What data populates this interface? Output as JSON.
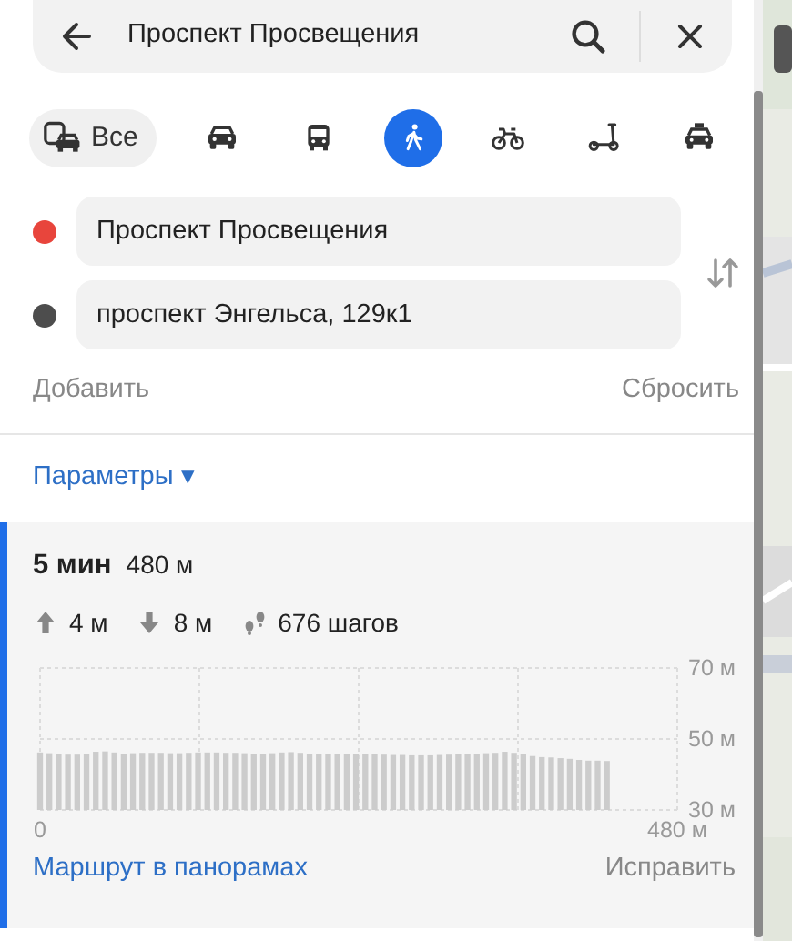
{
  "search": {
    "value": "Проспект Просвещения"
  },
  "modes": [
    {
      "kind": "all",
      "label": "Все",
      "selected": false
    },
    {
      "kind": "car",
      "selected": false
    },
    {
      "kind": "bus",
      "selected": false
    },
    {
      "kind": "walk",
      "selected": true
    },
    {
      "kind": "bike",
      "selected": false
    },
    {
      "kind": "scooter",
      "selected": false
    },
    {
      "kind": "taxi",
      "selected": false
    }
  ],
  "route_points": [
    {
      "value": "Проспект Просвещения",
      "color": "#e8453c"
    },
    {
      "value": "проспект Энгельса, 129к1",
      "color": "#4d4d4d"
    }
  ],
  "add_label": "Добавить",
  "reset_label": "Сбросить",
  "parameters": {
    "label": "Параметры",
    "caret": "▾"
  },
  "route": {
    "selected": true,
    "time": "5 мин",
    "distance": "480 м",
    "ascent": "4 м",
    "descent": "8 м",
    "steps": "676 шагов",
    "chart_data": {
      "type": "bar",
      "xlim": [
        0,
        480
      ],
      "ylim": [
        30,
        70
      ],
      "xticks": [
        {
          "value": 0,
          "label": "0"
        },
        {
          "value": 480,
          "label": "480 м"
        }
      ],
      "yticks": [
        {
          "value": 70,
          "label": "70 м"
        },
        {
          "value": 50,
          "label": "50 м"
        },
        {
          "value": 30,
          "label": "30 м"
        }
      ],
      "x": [
        0,
        7,
        14,
        21,
        28,
        35,
        42,
        49,
        56,
        63,
        70,
        77,
        84,
        91,
        98,
        105,
        112,
        119,
        126,
        133,
        140,
        147,
        154,
        161,
        168,
        175,
        182,
        189,
        196,
        203,
        210,
        217,
        224,
        231,
        238,
        245,
        252,
        259,
        266,
        273,
        280,
        287,
        294,
        301,
        308,
        315,
        322,
        329,
        336,
        343,
        350,
        357,
        364,
        371,
        378,
        385,
        392,
        399,
        406,
        413,
        420,
        427
      ],
      "values": [
        46.2,
        46,
        45.8,
        45.6,
        45.6,
        45.9,
        46.4,
        46.5,
        46.2,
        45.9,
        46,
        46.1,
        46.1,
        46.1,
        46,
        46,
        46.1,
        46.2,
        46.2,
        46.2,
        46.1,
        46.1,
        46,
        45.9,
        45.8,
        46,
        46.2,
        46.3,
        46.1,
        45.9,
        45.8,
        45.8,
        45.8,
        45.8,
        45.8,
        45.7,
        45.7,
        45.6,
        45.5,
        45.5,
        45.4,
        45.4,
        45.4,
        45.5,
        45.6,
        45.7,
        45.8,
        45.9,
        46,
        46.1,
        46.4,
        46.1,
        45.7,
        45.2,
        44.9,
        44.8,
        44.6,
        44.4,
        44.1,
        43.9,
        43.9,
        43.8
      ]
    },
    "panorama_link": "Маршрут в панорамах",
    "fix_link": "Исправить"
  }
}
